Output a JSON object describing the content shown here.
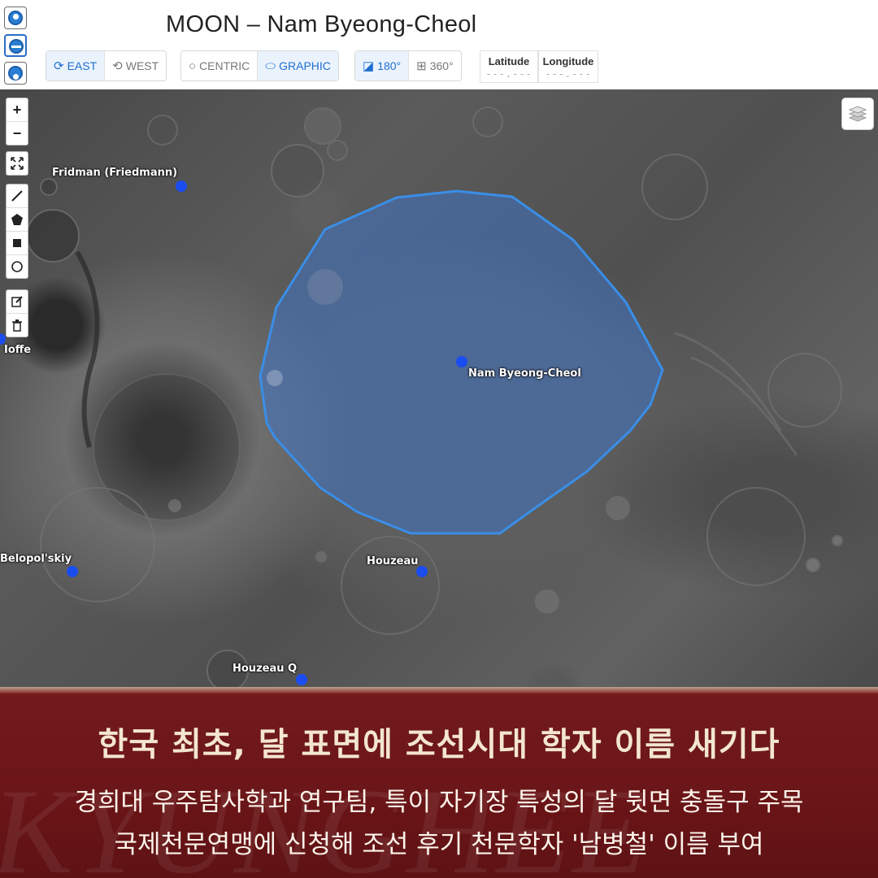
{
  "map_title": "MOON – Nam Byeong-Cheol",
  "projection_buttons": [
    "north-polar",
    "equatorial",
    "south-polar"
  ],
  "direction": {
    "east": "EAST",
    "west": "WEST"
  },
  "latitude_type": {
    "centric": "CENTRIC",
    "graphic": "GRAPHIC"
  },
  "longitude_range": {
    "r180": "180°",
    "r360": "360°"
  },
  "coords": {
    "latitude_label": "Latitude",
    "latitude_value": "---.---",
    "longitude_label": "Longitude",
    "longitude_value": "---.---"
  },
  "map_controls": {
    "zoom_in": "+",
    "zoom_out": "−"
  },
  "features": [
    {
      "name": "Fridman (Friedmann)"
    },
    {
      "name": "Ioffe"
    },
    {
      "name": "Nam Byeong-Cheol"
    },
    {
      "name": "Belopol'skiy"
    },
    {
      "name": "Houzeau"
    },
    {
      "name": "Houzeau Q"
    }
  ],
  "colors": {
    "accent": "#1f6fd1",
    "marker": "#1a4cf0",
    "polygon_stroke": "#3a8ee6",
    "banner": "#6a1517"
  },
  "banner": {
    "headline": "한국 최초, 달 표면에 조선시대 학자 이름 새기다",
    "line1": "경희대 우주탐사학과 연구팀, 특이 자기장 특성의 달 뒷면 충돌구 주목",
    "line2": "국제천문연맹에 신청해 조선 후기 천문학자 '남병철' 이름 부여",
    "watermark": "KYUNGHEE"
  }
}
